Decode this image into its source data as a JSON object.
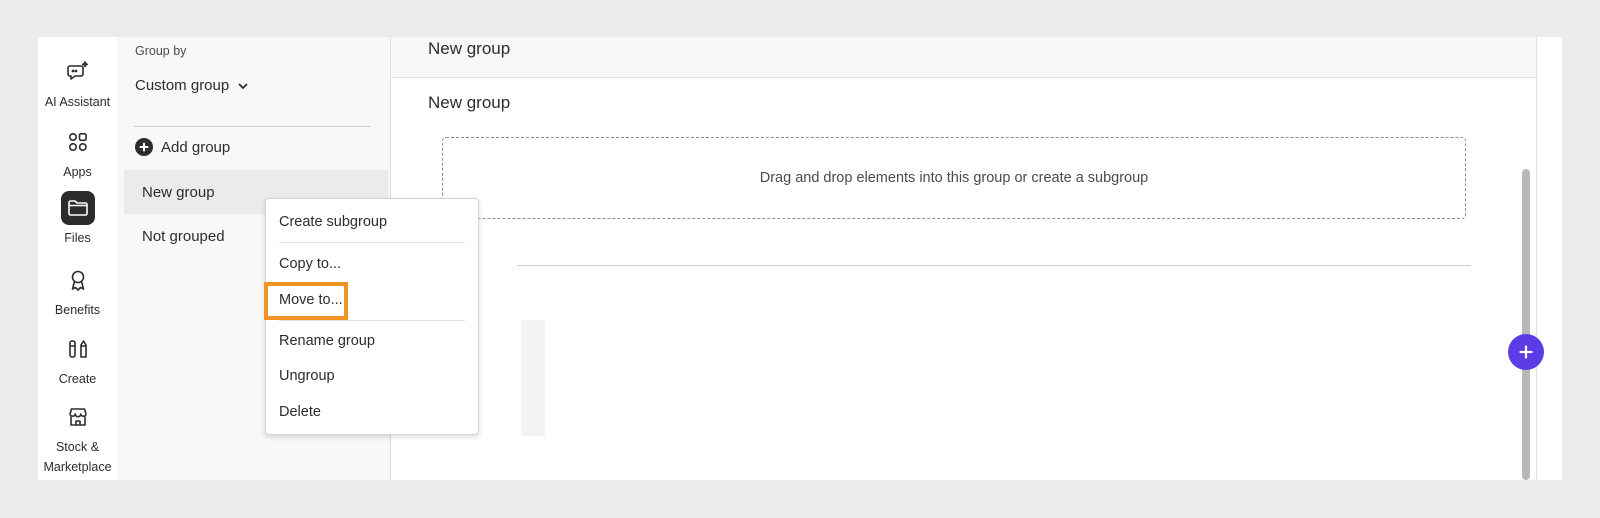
{
  "rail": {
    "items": [
      {
        "label": "AI Assistant",
        "icon": "ai-assistant-icon"
      },
      {
        "label": "Apps",
        "icon": "apps-icon"
      },
      {
        "label": "Files",
        "icon": "folder-icon",
        "active": true
      },
      {
        "label": "Benefits",
        "icon": "award-icon"
      },
      {
        "label": "Create",
        "icon": "create-icon"
      },
      {
        "label": "Stock &",
        "label2": "Marketplace",
        "icon": "store-icon"
      }
    ]
  },
  "group_panel": {
    "group_by_label": "Group by",
    "group_select_value": "Custom group",
    "add_group_label": "Add group",
    "groups": [
      "New group",
      "Not grouped"
    ]
  },
  "main": {
    "header_title": "New group",
    "section_title": "New group",
    "dropzone_text": "Drag and drop elements into this group or create a subgroup"
  },
  "context_menu": {
    "items": [
      "Create subgroup",
      "Copy to...",
      "Move to...",
      "Rename group",
      "Ungroup",
      "Delete"
    ]
  },
  "colors": {
    "accent": "#5c3ce6",
    "highlight": "#f29423"
  }
}
